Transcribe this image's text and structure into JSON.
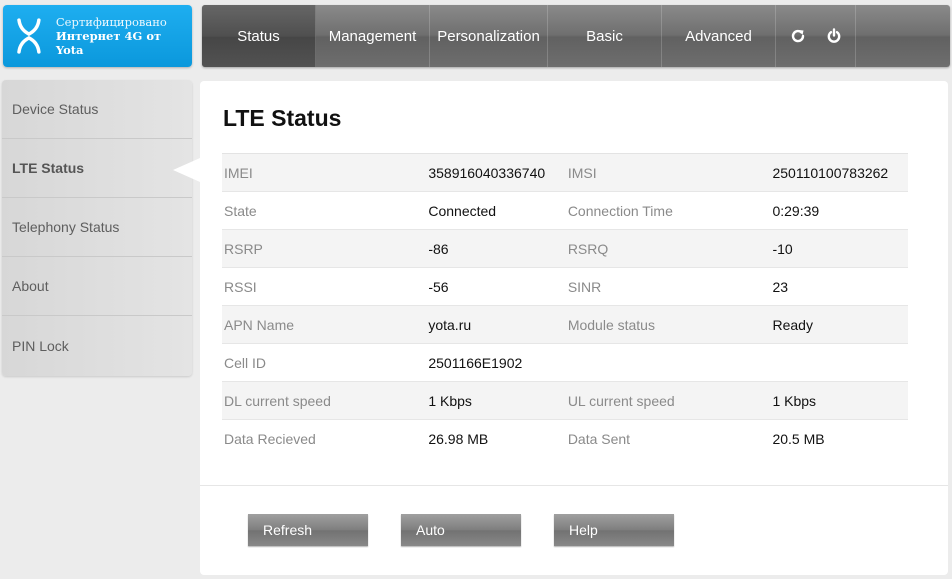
{
  "logo": {
    "line1": "Сертифицировано",
    "line2": "Интернет 4G от Yota"
  },
  "nav": {
    "tabs": [
      "Status",
      "Management",
      "Personalization",
      "Basic",
      "Advanced"
    ],
    "active": "Status"
  },
  "sidebar": {
    "items": [
      {
        "label": "Device Status"
      },
      {
        "label": "LTE Status"
      },
      {
        "label": "Telephony Status"
      },
      {
        "label": "About"
      },
      {
        "label": "PIN Lock"
      }
    ],
    "active": "LTE Status"
  },
  "main": {
    "title": "LTE Status",
    "rows": [
      [
        "IMEI",
        "358916040336740",
        "IMSI",
        "250110100783262"
      ],
      [
        "State",
        "Connected",
        "Connection Time",
        "0:29:39"
      ],
      [
        "RSRP",
        "-86",
        "RSRQ",
        "-10"
      ],
      [
        "RSSI",
        "-56",
        "SINR",
        "23"
      ],
      [
        "APN Name",
        "yota.ru",
        "Module status",
        "Ready"
      ],
      [
        "Cell ID",
        "2501166E1902",
        "",
        ""
      ],
      [
        "DL current speed",
        "1 Kbps",
        "UL current speed",
        "1 Kbps"
      ],
      [
        "Data Recieved",
        "26.98 MB",
        "Data Sent",
        "20.5 MB"
      ]
    ]
  },
  "buttons": {
    "refresh": "Refresh",
    "auto": "Auto",
    "help": "Help"
  },
  "icons": {
    "refresh": "refresh-icon",
    "power": "power-icon"
  },
  "colors": {
    "brand": "#1eaef0",
    "nav": "#6f6f6f",
    "active_tab": "#4f4f4f"
  }
}
